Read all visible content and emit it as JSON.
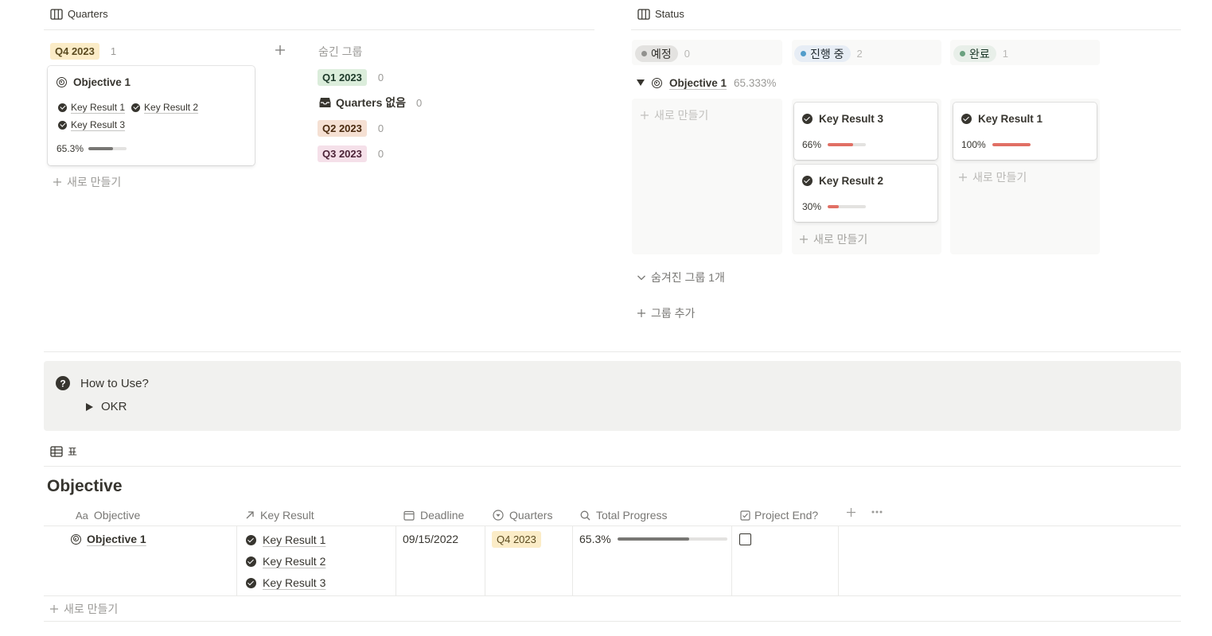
{
  "quarters_view": {
    "title": "Quarters",
    "group": {
      "label": "Q4 2023",
      "count": "1"
    },
    "card": {
      "title": "Objective 1",
      "key_results": [
        "Key Result 1",
        "Key Result 2",
        "Key Result 3"
      ],
      "progress_text": "65.3%",
      "progress": 0.653
    },
    "new_label": "새로 만들기",
    "hidden_groups_title": "숨긴 그룹",
    "hidden_groups": [
      {
        "label": "Q1 2023",
        "count": "0"
      },
      {
        "label": "Quarters 없음",
        "count": "0"
      },
      {
        "label": "Q2 2023",
        "count": "0"
      },
      {
        "label": "Q3 2023",
        "count": "0"
      }
    ]
  },
  "status_view": {
    "title": "Status",
    "columns": [
      {
        "label": "예정",
        "count": "0",
        "dot_color": "#91918e"
      },
      {
        "label": "진행 중",
        "count": "2",
        "dot_color": "#529cca"
      },
      {
        "label": "완료",
        "count": "1",
        "dot_color": "#4dab9a"
      }
    ],
    "group_row": {
      "title": "Objective 1",
      "value": "65.333%"
    },
    "cards": [
      {
        "title": "Key Result 3",
        "pct": "66%",
        "progress": 0.66
      },
      {
        "title": "Key Result 2",
        "pct": "30%",
        "progress": 0.3
      },
      {
        "title": "Key Result 1",
        "pct": "100%",
        "progress": 1.0
      }
    ],
    "new_label": "새로 만들기",
    "hidden_groups_label": "숨겨진 그룹 1개",
    "add_group_label": "그룹 추가"
  },
  "callout": {
    "title": "How to Use?",
    "toggle_label": "OKR"
  },
  "table_view": {
    "tab_label": "표",
    "title": "Objective",
    "columns": [
      "Objective",
      "Key Result",
      "Deadline",
      "Quarters",
      "Total Progress",
      "Project End?"
    ],
    "objective_prefix": "Aa",
    "row": {
      "objective": "Objective 1",
      "key_results": [
        "Key Result 1",
        "Key Result 2",
        "Key Result 3"
      ],
      "deadline": "09/15/2022",
      "quarter": "Q4 2023",
      "progress_text": "65.3%",
      "progress": 0.653
    },
    "new_label": "새로 만들기"
  },
  "colors": {
    "q4_bg": "#fbecc7",
    "q4_fg": "#5a4a1f",
    "q1_bg": "#dbeddb",
    "q1_fg": "#1c3829",
    "q2_bg": "#f5e0d3",
    "q2_fg": "#49290e",
    "q3_bg": "#f5e0e9",
    "q3_fg": "#4c2337",
    "red_bar": "#e16f64",
    "gray_bar": "#787774"
  },
  "icons": [
    "board-icon",
    "plus-icon",
    "inbox-icon",
    "target-icon",
    "check-circle-icon",
    "question-icon",
    "toggle-triangle-icon",
    "table-icon",
    "arrow-relation-icon",
    "calendar-icon",
    "select-icon",
    "search-formula-icon",
    "checkbox-icon",
    "more-icon",
    "chevron-down-icon"
  ]
}
